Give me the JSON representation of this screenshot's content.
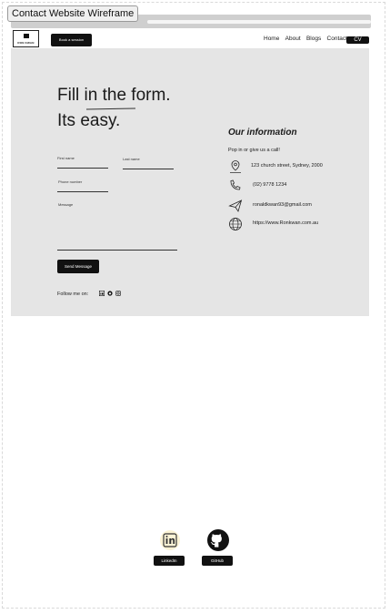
{
  "frame": {
    "title": "Contact Website Wireframe"
  },
  "nav": {
    "logo_text": "RON KWAN",
    "book_button": "Book a session",
    "links": [
      "Home",
      "About",
      "Blogs",
      "Contact"
    ],
    "cv_button": "CV"
  },
  "form": {
    "headline_line1": "Fill in the form.",
    "headline_line2": "Its easy.",
    "first_name_label": "First name",
    "last_name_label": "Last name",
    "phone_label": "Phone number",
    "message_label": "Message",
    "send_button": "Send Message",
    "follow_label": "Follow me on:"
  },
  "info": {
    "title": "Our information",
    "subtitle": "Pop in or give us a call!",
    "address": "123 church street, Sydney, 2000",
    "phone": "(02) 9778 1234",
    "email": "ronaldkwan93@gmail.com",
    "website": "https://www.Ronkwan.com.au"
  },
  "social": {
    "linkedin_label": "LinkedIn",
    "github_label": "GitHub"
  },
  "colors": {
    "hero_bg": "#e5e5e5",
    "button_bg": "#111111",
    "chrome": "#cfcfcf"
  }
}
